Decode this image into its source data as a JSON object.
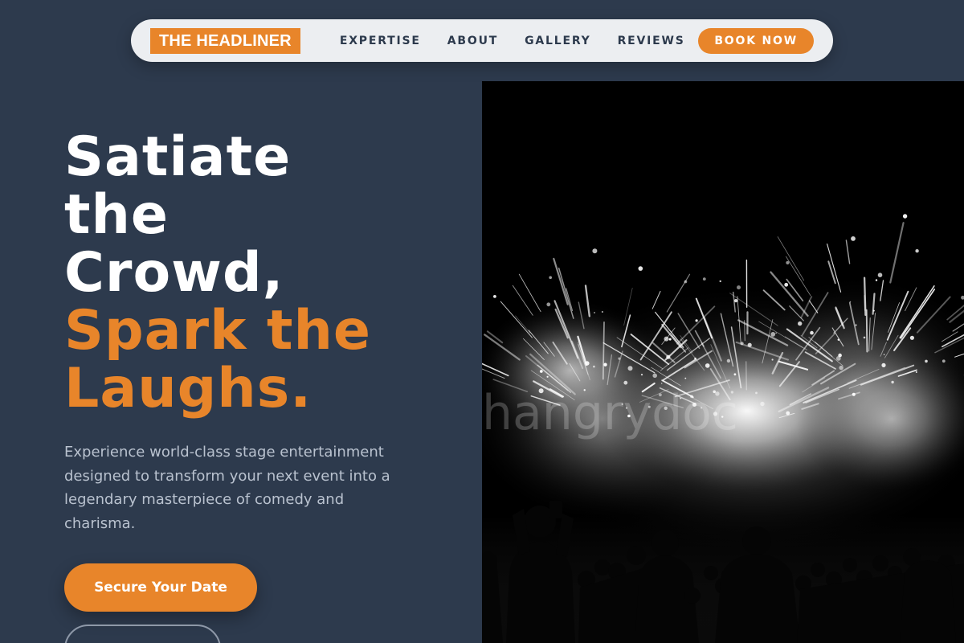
{
  "nav": {
    "brand": "THE HEADLINER",
    "links": [
      {
        "label": "EXPERTISE"
      },
      {
        "label": "ABOUT"
      },
      {
        "label": "GALLERY"
      },
      {
        "label": "REVIEWS"
      }
    ],
    "cta": "BOOK NOW"
  },
  "hero": {
    "headline_white": [
      "Satiate",
      "the",
      "Crowd,"
    ],
    "headline_accent": [
      "Spark the",
      "Laughs."
    ],
    "description": "Experience world-class stage entertainment designed to transform your next event into a legendary masterpiece of comedy and charisma.",
    "primary_cta": "Secure Your Date",
    "secondary_cta": ""
  },
  "image": {
    "subject": "black-and-white fireworks over crowd silhouettes",
    "watermark": "hangrydoc"
  },
  "colors": {
    "background": "#2d3a4d",
    "accent": "#e8852a",
    "nav_bg": "#eceef1",
    "text_muted": "#b9c2cf"
  }
}
